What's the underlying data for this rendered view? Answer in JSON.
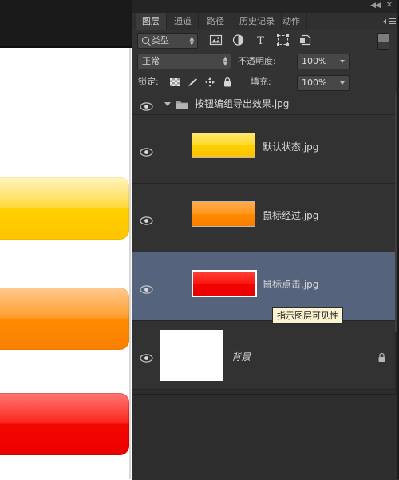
{
  "window": {
    "collapse_label": "◀◀",
    "close_label": "✕"
  },
  "tabs": [
    {
      "label": "图层",
      "active": true
    },
    {
      "label": "通道",
      "active": false
    },
    {
      "label": "路径",
      "active": false
    },
    {
      "label": "历史记录",
      "active": false
    },
    {
      "label": "动作",
      "active": false
    }
  ],
  "panel_menu_icon": "panel-menu-icon",
  "filter_bar": {
    "select_value": "类型",
    "search_icon": "search-icon",
    "icons": [
      {
        "name": "pixel-layer-filter-icon"
      },
      {
        "name": "adjustment-layer-filter-icon"
      },
      {
        "name": "type-layer-filter-icon"
      },
      {
        "name": "shape-layer-filter-icon"
      },
      {
        "name": "smart-object-filter-icon"
      }
    ],
    "toggle_name": "filter-enable-toggle"
  },
  "properties": {
    "blend_mode": "正常",
    "opacity_label": "不透明度:",
    "opacity_value": "100%",
    "lock_label": "锁定:",
    "fill_label": "填充:",
    "fill_value": "100%",
    "lock_icons": [
      {
        "name": "lock-transparent-pixels-icon"
      },
      {
        "name": "lock-image-pixels-icon"
      },
      {
        "name": "lock-position-icon"
      },
      {
        "name": "lock-all-icon"
      }
    ]
  },
  "layers": [
    {
      "name": "按钮编组导出效果.jpg",
      "type": "group",
      "visible": true,
      "selected": false,
      "expanded": true,
      "locked": false
    },
    {
      "name": "默认状态.jpg",
      "type": "layer",
      "visible": true,
      "selected": false,
      "locked": false,
      "thumb_color": "#ffd51e"
    },
    {
      "name": "鼠标经过.jpg",
      "type": "layer",
      "visible": true,
      "selected": false,
      "locked": false,
      "thumb_color": "#ff8b0a"
    },
    {
      "name": "鼠标点击.jpg",
      "type": "layer",
      "visible": true,
      "selected": true,
      "locked": false,
      "thumb_color": "#f50a06"
    },
    {
      "name": "背景",
      "type": "background",
      "visible": true,
      "selected": false,
      "locked": true,
      "thumb_color": "#ffffff"
    }
  ],
  "tooltip": {
    "text": "指示图层可见性"
  },
  "colors": {
    "panel_bg": "#2b2b2b",
    "row_bg": "#323232",
    "row_selected": "#56637d",
    "tooltip_bg": "#fbf4d0",
    "text": "#d8d8d8"
  },
  "canvas_art": {
    "buttons": [
      {
        "name": "default-state-button-art",
        "color_top": "#ffe14f",
        "color_bottom": "#ffc400"
      },
      {
        "name": "hover-state-button-art",
        "color_top": "#ffa33f",
        "color_bottom": "#fa7f00"
      },
      {
        "name": "active-state-button-art",
        "color_top": "#ff3b34",
        "color_bottom": "#ec0000"
      }
    ]
  }
}
